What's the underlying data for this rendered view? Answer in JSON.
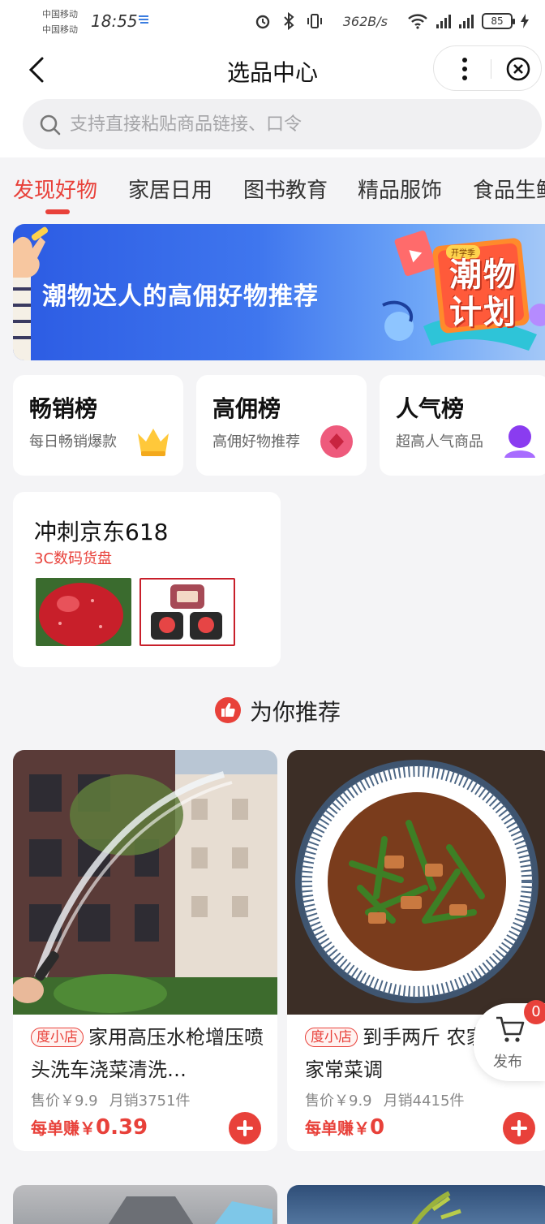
{
  "status_bar": {
    "carrier_1": "中国移动",
    "carrier_2": "中国移动",
    "time": "18:55",
    "net_speed": "362B/s",
    "battery": "85"
  },
  "nav": {
    "title": "选品中心"
  },
  "search": {
    "placeholder": "支持直接粘贴商品链接、口令"
  },
  "tabs": [
    {
      "label": "发现好物",
      "active": true
    },
    {
      "label": "家居日用",
      "active": false
    },
    {
      "label": "图书教育",
      "active": false
    },
    {
      "label": "精品服饰",
      "active": false
    },
    {
      "label": "食品生鲜",
      "active": false
    }
  ],
  "banner": {
    "text": "潮物达人的高佣好物推荐",
    "badge_line_1": "潮物",
    "badge_line_2": "计划",
    "badge_tag": "开学季"
  },
  "rank_cards": [
    {
      "title": "畅销榜",
      "subtitle": "每日畅销爆款",
      "icon": "crown-icon"
    },
    {
      "title": "高佣榜",
      "subtitle": "高佣好物推荐",
      "icon": "diamond-icon"
    },
    {
      "title": "人气榜",
      "subtitle": "超高人气商品",
      "icon": "user-icon"
    }
  ],
  "promo": {
    "title": "冲刺京东618",
    "subtitle": "3C数码货盘"
  },
  "recommend": {
    "title": "为你推荐"
  },
  "products": [
    {
      "shop_tag": "度小店",
      "name": "家用高压水枪增压喷头洗车浇菜清洗…",
      "price": "售价￥9.9",
      "sales": "月销3751件",
      "earn_label": "每单赚￥",
      "earn_amount": "0.39"
    },
    {
      "shop_tag": "度小店",
      "name": "到手两斤 农家小炒酱家常菜调",
      "price": "售价￥9.9",
      "sales": "月销4415件",
      "earn_label": "每单赚￥",
      "earn_amount": "0"
    }
  ],
  "fab": {
    "label": "发布",
    "badge": "0"
  },
  "colors": {
    "accent": "#e8413a",
    "banner_blue": "#2c5be3",
    "background": "#f4f4f6"
  }
}
